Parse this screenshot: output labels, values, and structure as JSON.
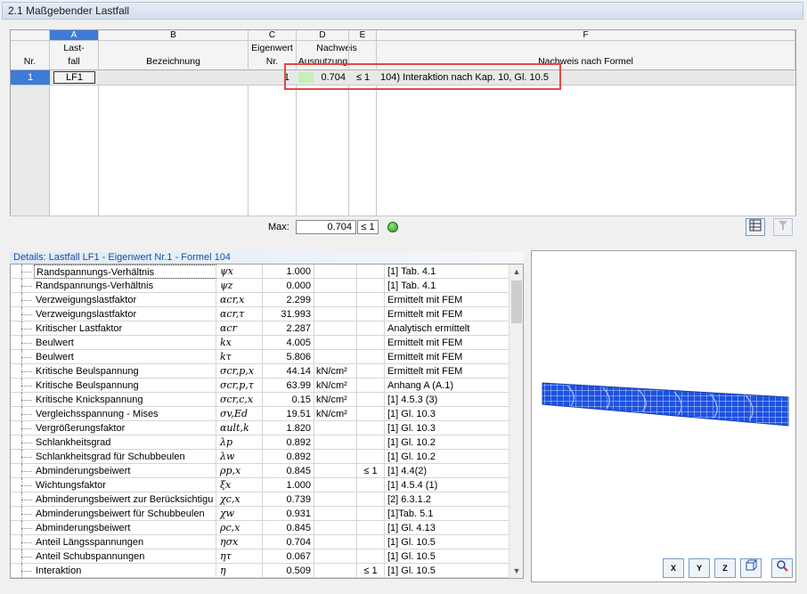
{
  "panel": {
    "title": "2.1 Maßgebender Lastfall"
  },
  "grid": {
    "letters": [
      "A",
      "B",
      "C",
      "D",
      "E",
      "F"
    ],
    "headers": {
      "nr": "Nr.",
      "lastfall_l1": "Last-",
      "lastfall_l2": "fall",
      "bezeichnung": "Bezeichnung",
      "eigenwert_l1": "Eigenwert",
      "eigenwert_l2": "Nr.",
      "nachweis_l1": "Nachweis",
      "nachweis_l2": "Ausnutzung",
      "formel": "Nachweis nach Formel"
    },
    "row": {
      "nr": "1",
      "lastfall": "LF1",
      "bezeichnung": "",
      "eigenwert": "1",
      "ausnutzung": "0.704",
      "le": "≤ 1",
      "formel": "104) Interaktion nach Kap. 10, Gl. 10.5",
      "utilization_fraction": 0.704
    },
    "max": {
      "label": "Max:",
      "value": "0.704",
      "le": "≤ 1"
    }
  },
  "details": {
    "title": "Details: Lastfall LF1 - Eigenwert Nr.1 - Formel 104",
    "rows": [
      {
        "name": "Randspannungs-Verhältnis",
        "sym": "ψx",
        "val": "1.000",
        "unit": "",
        "le": "",
        "ref": "[1] Tab. 4.1"
      },
      {
        "name": "Randspannungs-Verhältnis",
        "sym": "ψz",
        "val": "0.000",
        "unit": "",
        "le": "",
        "ref": "[1] Tab. 4.1"
      },
      {
        "name": "Verzweigungslastfaktor",
        "sym": "αcr,x",
        "val": "2.299",
        "unit": "",
        "le": "",
        "ref": "Ermittelt mit FEM"
      },
      {
        "name": "Verzweigungslastfaktor",
        "sym": "αcr,τ",
        "val": "31.993",
        "unit": "",
        "le": "",
        "ref": "Ermittelt mit FEM"
      },
      {
        "name": "Kritischer Lastfaktor",
        "sym": "αcr",
        "val": "2.287",
        "unit": "",
        "le": "",
        "ref": "Analytisch ermittelt"
      },
      {
        "name": "Beulwert",
        "sym": "kx",
        "val": "4.005",
        "unit": "",
        "le": "",
        "ref": "Ermittelt mit FEM"
      },
      {
        "name": "Beulwert",
        "sym": "kτ",
        "val": "5.806",
        "unit": "",
        "le": "",
        "ref": "Ermittelt mit FEM"
      },
      {
        "name": "Kritische Beulspannung",
        "sym": "σcr,p,x",
        "val": "44.14",
        "unit": "kN/cm²",
        "le": "",
        "ref": "Ermittelt mit FEM"
      },
      {
        "name": "Kritische Beulspannung",
        "sym": "σcr,p,τ",
        "val": "63.99",
        "unit": "kN/cm²",
        "le": "",
        "ref": "Anhang A (A.1)"
      },
      {
        "name": "Kritische Knickspannung",
        "sym": "σcr,c,x",
        "val": "0.15",
        "unit": "kN/cm²",
        "le": "",
        "ref": "[1] 4.5.3 (3)"
      },
      {
        "name": "Vergleichsspannung - Mises",
        "sym": "σv,Ed",
        "val": "19.51",
        "unit": "kN/cm²",
        "le": "",
        "ref": "[1] Gl. 10.3"
      },
      {
        "name": "Vergrößerungsfaktor",
        "sym": "αult,k",
        "val": "1.820",
        "unit": "",
        "le": "",
        "ref": "[1] Gl. 10.3"
      },
      {
        "name": "Schlankheitsgrad",
        "sym": "λp",
        "val": "0.892",
        "unit": "",
        "le": "",
        "ref": "[1] Gl. 10.2"
      },
      {
        "name": "Schlankheitsgrad für Schubbeulen",
        "sym": "λw",
        "val": "0.892",
        "unit": "",
        "le": "",
        "ref": "[1] Gl. 10.2"
      },
      {
        "name": "Abminderungsbeiwert",
        "sym": "ρp,x",
        "val": "0.845",
        "unit": "",
        "le": "≤ 1",
        "ref": "[1] 4.4(2)"
      },
      {
        "name": "Wichtungsfaktor",
        "sym": "ξx",
        "val": "1.000",
        "unit": "",
        "le": "",
        "ref": "[1] 4.5.4 (1)"
      },
      {
        "name": "Abminderungsbeiwert zur Berücksichtigu",
        "sym": "χc,x",
        "val": "0.739",
        "unit": "",
        "le": "",
        "ref": "[2] 6.3.1.2"
      },
      {
        "name": "Abminderungsbeiwert für Schubbeulen",
        "sym": "χw",
        "val": "0.931",
        "unit": "",
        "le": "",
        "ref": "[1]Tab. 5.1"
      },
      {
        "name": "Abminderungsbeiwert",
        "sym": "ρc,x",
        "val": "0.845",
        "unit": "",
        "le": "",
        "ref": "[1] Gl. 4.13"
      },
      {
        "name": "Anteil Längsspannungen",
        "sym": "ησx",
        "val": "0.704",
        "unit": "",
        "le": "",
        "ref": "[1] Gl. 10.5"
      },
      {
        "name": "Anteil Schubspannungen",
        "sym": "ητ",
        "val": "0.067",
        "unit": "",
        "le": "",
        "ref": "[1] Gl. 10.5"
      },
      {
        "name": "Interaktion",
        "sym": "η",
        "val": "0.509",
        "unit": "",
        "le": "≤ 1",
        "ref": "[1] Gl. 10.5"
      }
    ]
  },
  "view_buttons": [
    "X",
    "Y",
    "Z",
    "",
    ""
  ]
}
